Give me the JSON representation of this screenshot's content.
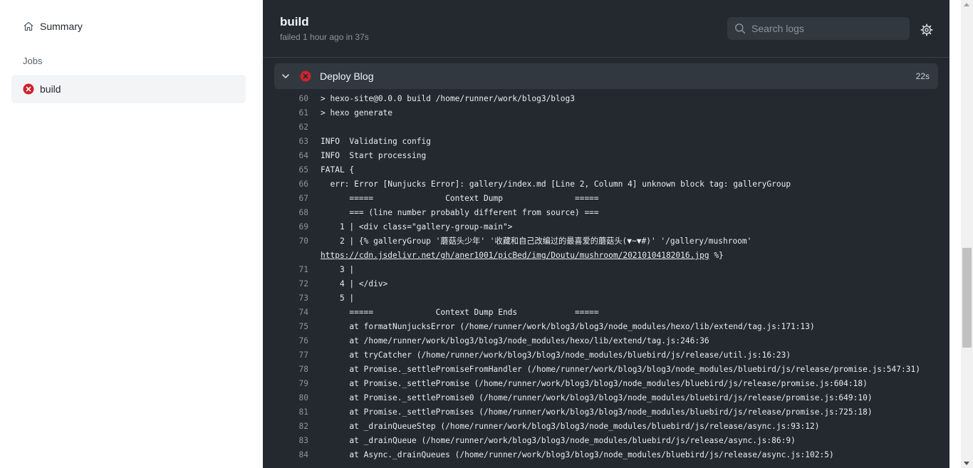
{
  "sidebar": {
    "summary_label": "Summary",
    "jobs_heading": "Jobs",
    "jobs": [
      {
        "label": "build",
        "status": "failed"
      }
    ]
  },
  "header": {
    "job_title": "build",
    "job_status": "failed 1 hour ago in 37s",
    "search_placeholder": "Search logs"
  },
  "step": {
    "name": "Deploy Blog",
    "duration": "22s"
  },
  "colors": {
    "fail": "#cf222e",
    "panel_bg": "#24292f",
    "step_bg": "#32383f"
  },
  "log_lines": [
    {
      "num": "60",
      "text": "> hexo-site@0.0.0 build /home/runner/work/blog3/blog3"
    },
    {
      "num": "61",
      "text": "> hexo generate"
    },
    {
      "num": "62",
      "text": ""
    },
    {
      "num": "63",
      "text": "INFO  Validating config"
    },
    {
      "num": "64",
      "text": "INFO  Start processing"
    },
    {
      "num": "65",
      "text": "FATAL {"
    },
    {
      "num": "66",
      "text": "  err: Error [Nunjucks Error]: gallery/index.md [Line 2, Column 4] unknown block tag: galleryGroup"
    },
    {
      "num": "67",
      "text": "      =====               Context Dump               ====="
    },
    {
      "num": "68",
      "text": "      === (line number probably different from source) ==="
    },
    {
      "num": "69",
      "text": "    1 | <div class=\"gallery-group-main\">"
    },
    {
      "num": "70",
      "text": "    2 | {% galleryGroup '蘑菇头少年' '收藏和自己改编过的最喜爱的蘑菇头(▼~▼#)' '/gallery/mushroom'"
    },
    {
      "num": "",
      "text": "https://cdn.jsdelivr.net/gh/aner1001/picBed/img/Doutu/mushroom/20210104182016.jpg",
      "suffix": " %}"
    },
    {
      "num": "71",
      "text": "    3 |"
    },
    {
      "num": "72",
      "text": "    4 | </div>"
    },
    {
      "num": "73",
      "text": "    5 |"
    },
    {
      "num": "74",
      "text": "      =====             Context Dump Ends            ====="
    },
    {
      "num": "75",
      "text": "      at formatNunjucksError (/home/runner/work/blog3/blog3/node_modules/hexo/lib/extend/tag.js:171:13)"
    },
    {
      "num": "76",
      "text": "      at /home/runner/work/blog3/blog3/node_modules/hexo/lib/extend/tag.js:246:36"
    },
    {
      "num": "77",
      "text": "      at tryCatcher (/home/runner/work/blog3/blog3/node_modules/bluebird/js/release/util.js:16:23)"
    },
    {
      "num": "78",
      "text": "      at Promise._settlePromiseFromHandler (/home/runner/work/blog3/blog3/node_modules/bluebird/js/release/promise.js:547:31)"
    },
    {
      "num": "79",
      "text": "      at Promise._settlePromise (/home/runner/work/blog3/blog3/node_modules/bluebird/js/release/promise.js:604:18)"
    },
    {
      "num": "80",
      "text": "      at Promise._settlePromise0 (/home/runner/work/blog3/blog3/node_modules/bluebird/js/release/promise.js:649:10)"
    },
    {
      "num": "81",
      "text": "      at Promise._settlePromises (/home/runner/work/blog3/blog3/node_modules/bluebird/js/release/promise.js:725:18)"
    },
    {
      "num": "82",
      "text": "      at _drainQueueStep (/home/runner/work/blog3/blog3/node_modules/bluebird/js/release/async.js:93:12)"
    },
    {
      "num": "83",
      "text": "      at _drainQueue (/home/runner/work/blog3/blog3/node_modules/bluebird/js/release/async.js:86:9)"
    },
    {
      "num": "84",
      "text": "      at Async._drainQueues (/home/runner/work/blog3/blog3/node_modules/bluebird/js/release/async.js:102:5)"
    }
  ]
}
